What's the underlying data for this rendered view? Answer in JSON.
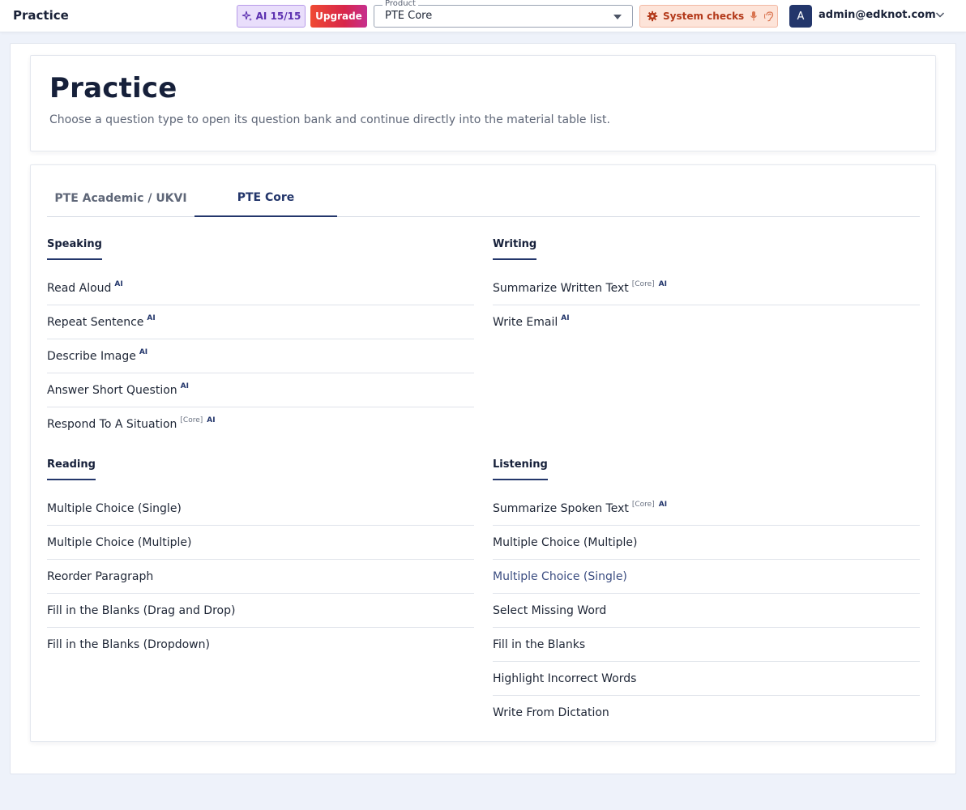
{
  "topbar": {
    "title": "Practice",
    "ai_chip": "AI 15/15",
    "upgrade": "Upgrade",
    "product_label": "Product",
    "product_value": "PTE Core",
    "system_checks": "System checks",
    "avatar_letter": "A",
    "user_email": "admin@edknot.com"
  },
  "header": {
    "title": "Practice",
    "subtitle": "Choose a question type to open its question bank and continue directly into the material table list."
  },
  "tabs": [
    {
      "label": "PTE Academic / UKVI",
      "active": false
    },
    {
      "label": "PTE Core",
      "active": true
    }
  ],
  "sections": {
    "speaking": {
      "title": "Speaking",
      "items": [
        {
          "label": "Read Aloud",
          "core": "",
          "ai": "AI"
        },
        {
          "label": "Repeat Sentence",
          "core": "",
          "ai": "AI"
        },
        {
          "label": "Describe Image",
          "core": "",
          "ai": "AI"
        },
        {
          "label": "Answer Short Question",
          "core": "",
          "ai": "AI"
        },
        {
          "label": "Respond To A Situation",
          "core": "[Core]",
          "ai": "AI"
        }
      ]
    },
    "writing": {
      "title": "Writing",
      "items": [
        {
          "label": "Summarize Written Text",
          "core": "[Core]",
          "ai": "AI"
        },
        {
          "label": "Write Email",
          "core": "",
          "ai": "AI"
        }
      ]
    },
    "reading": {
      "title": "Reading",
      "items": [
        {
          "label": "Multiple Choice (Single)",
          "core": "",
          "ai": ""
        },
        {
          "label": "Multiple Choice (Multiple)",
          "core": "",
          "ai": ""
        },
        {
          "label": "Reorder Paragraph",
          "core": "",
          "ai": ""
        },
        {
          "label": "Fill in the Blanks (Drag and Drop)",
          "core": "",
          "ai": ""
        },
        {
          "label": "Fill in the Blanks (Dropdown)",
          "core": "",
          "ai": ""
        }
      ]
    },
    "listening": {
      "title": "Listening",
      "items": [
        {
          "label": "Summarize Spoken Text",
          "core": "[Core]",
          "ai": "AI"
        },
        {
          "label": "Multiple Choice (Multiple)",
          "core": "",
          "ai": ""
        },
        {
          "label": "Multiple Choice (Single)",
          "core": "",
          "ai": "",
          "highlight": true
        },
        {
          "label": "Select Missing Word",
          "core": "",
          "ai": ""
        },
        {
          "label": "Fill in the Blanks",
          "core": "",
          "ai": ""
        },
        {
          "label": "Highlight Incorrect Words",
          "core": "",
          "ai": ""
        },
        {
          "label": "Write From Dictation",
          "core": "",
          "ai": ""
        }
      ]
    }
  },
  "colors": {
    "accent": "#23366b",
    "upgrade_start": "#ef4a32",
    "upgrade_end": "#c62f8f",
    "ai_chip_bg": "#e9defb",
    "system_checks_bg": "#fde4d9"
  },
  "icons": {
    "ai_chip": "sparkles-icon",
    "system_checks": "gear-icon",
    "mic": "microphone-icon",
    "hearing": "ear-icon",
    "user_menu": "chevron-down-icon"
  }
}
